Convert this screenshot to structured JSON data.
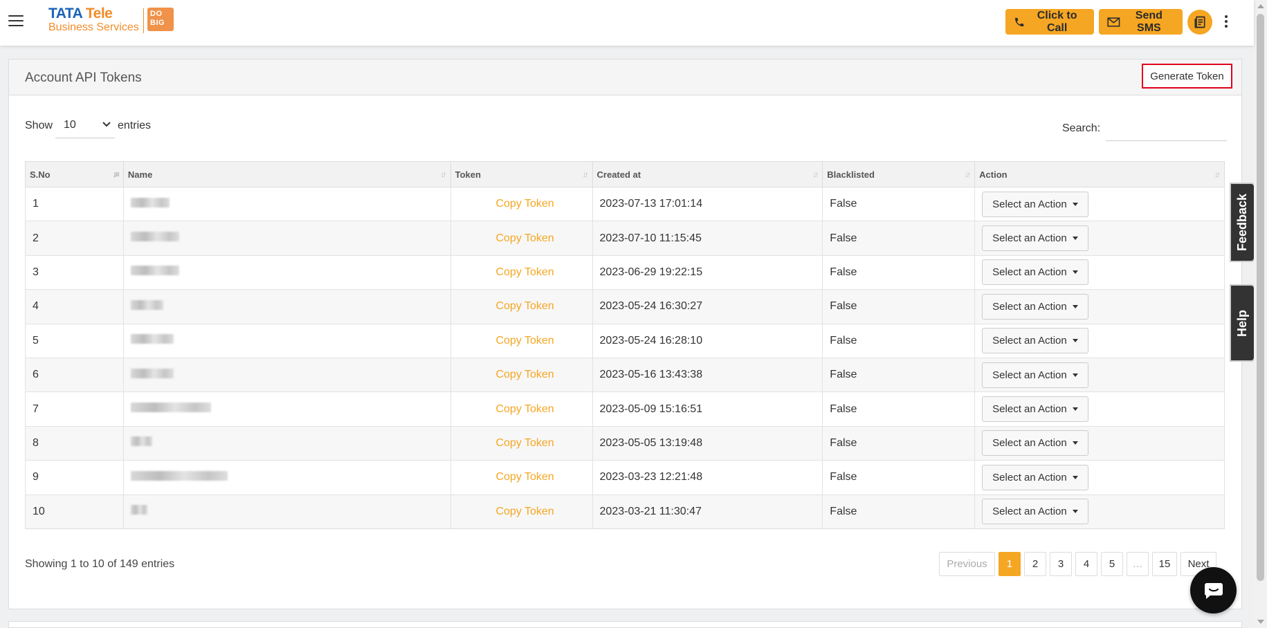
{
  "header": {
    "logo_line1_a": "TATA",
    "logo_line1_b": "Tele",
    "logo_line2": "Business Services",
    "logo_badge_top": "DO",
    "logo_badge_bottom": "BIG",
    "click_to_call": "Click to Call",
    "send_sms": "Send SMS"
  },
  "panel": {
    "title": "Account API Tokens",
    "generate_token": "Generate Token"
  },
  "controls": {
    "show_label": "Show",
    "entries_label": "entries",
    "page_length": "10",
    "search_label": "Search:",
    "search_value": ""
  },
  "table": {
    "columns": [
      "S.No",
      "Name",
      "Token",
      "Created at",
      "Blacklisted",
      "Action"
    ],
    "rows": [
      {
        "sno": "1",
        "token": "Copy Token",
        "created": "2023-07-13 17:01:14",
        "blacklisted": "False",
        "action": "Select an Action"
      },
      {
        "sno": "2",
        "token": "Copy Token",
        "created": "2023-07-10 11:15:45",
        "blacklisted": "False",
        "action": "Select an Action"
      },
      {
        "sno": "3",
        "token": "Copy Token",
        "created": "2023-06-29 19:22:15",
        "blacklisted": "False",
        "action": "Select an Action"
      },
      {
        "sno": "4",
        "token": "Copy Token",
        "created": "2023-05-24 16:30:27",
        "blacklisted": "False",
        "action": "Select an Action"
      },
      {
        "sno": "5",
        "token": "Copy Token",
        "created": "2023-05-24 16:28:10",
        "blacklisted": "False",
        "action": "Select an Action"
      },
      {
        "sno": "6",
        "token": "Copy Token",
        "created": "2023-05-16 13:43:38",
        "blacklisted": "False",
        "action": "Select an Action"
      },
      {
        "sno": "7",
        "token": "Copy Token",
        "created": "2023-05-09 15:16:51",
        "blacklisted": "False",
        "action": "Select an Action"
      },
      {
        "sno": "8",
        "token": "Copy Token",
        "created": "2023-05-05 13:19:48",
        "blacklisted": "False",
        "action": "Select an Action"
      },
      {
        "sno": "9",
        "token": "Copy Token",
        "created": "2023-03-23 12:21:48",
        "blacklisted": "False",
        "action": "Select an Action"
      },
      {
        "sno": "10",
        "token": "Copy Token",
        "created": "2023-03-21 11:30:47",
        "blacklisted": "False",
        "action": "Select an Action"
      }
    ]
  },
  "footer": {
    "info": "Showing 1 to 10 of 149 entries",
    "pagination": [
      "Previous",
      "1",
      "2",
      "3",
      "4",
      "5",
      "…",
      "15",
      "Next"
    ]
  },
  "side_tabs": {
    "feedback": "Feedback",
    "help": "Help"
  },
  "colors": {
    "accent": "#f5a623",
    "brand_blue": "#1a62b8",
    "highlight_border": "#e0001b"
  }
}
